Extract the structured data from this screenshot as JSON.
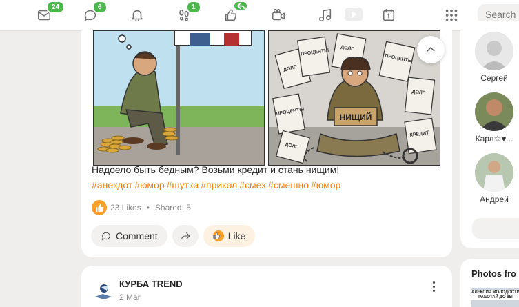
{
  "topbar": {
    "messages_badge": "24",
    "discussions_badge": "6",
    "guests_badge": "1",
    "search_placeholder": "Search"
  },
  "post": {
    "text": "Надоело быть бедным? Возьми кредит и стань нищим!",
    "hashtags": [
      "#анекдот",
      "#юмор",
      "#шутка",
      "#прикол",
      "#смех",
      "#смешно",
      "#юмор"
    ],
    "comic_sign": "НИЩИЙ",
    "comic_papers": [
      "ДОЛГ",
      "ПРОЦЕНТЫ",
      "ДОЛГ",
      "ПРОЦЕНТЫ",
      "ДОЛГ",
      "ПРОЦЕНТЫ",
      "КРЕДИТ",
      "ДОЛГ"
    ],
    "likes": "23 Likes",
    "shared": "Shared: 5",
    "comment_label": "Comment",
    "like_label": "Like"
  },
  "post2": {
    "author": "КУРБА TREND",
    "date": "2 Mar"
  },
  "sidebar": {
    "friends": [
      {
        "name": "Сергей"
      },
      {
        "name": "Карл☆♥..."
      },
      {
        "name": "Андрей"
      }
    ],
    "photos_title": "Photos fro",
    "photo_caption": "АЛЕКСИР МОЛОДОСТИ РАБОТАЙ ДО 85!"
  },
  "colors": {
    "accent": "#ee8208",
    "badge": "#4cb84c",
    "like": "#f7a02a"
  }
}
